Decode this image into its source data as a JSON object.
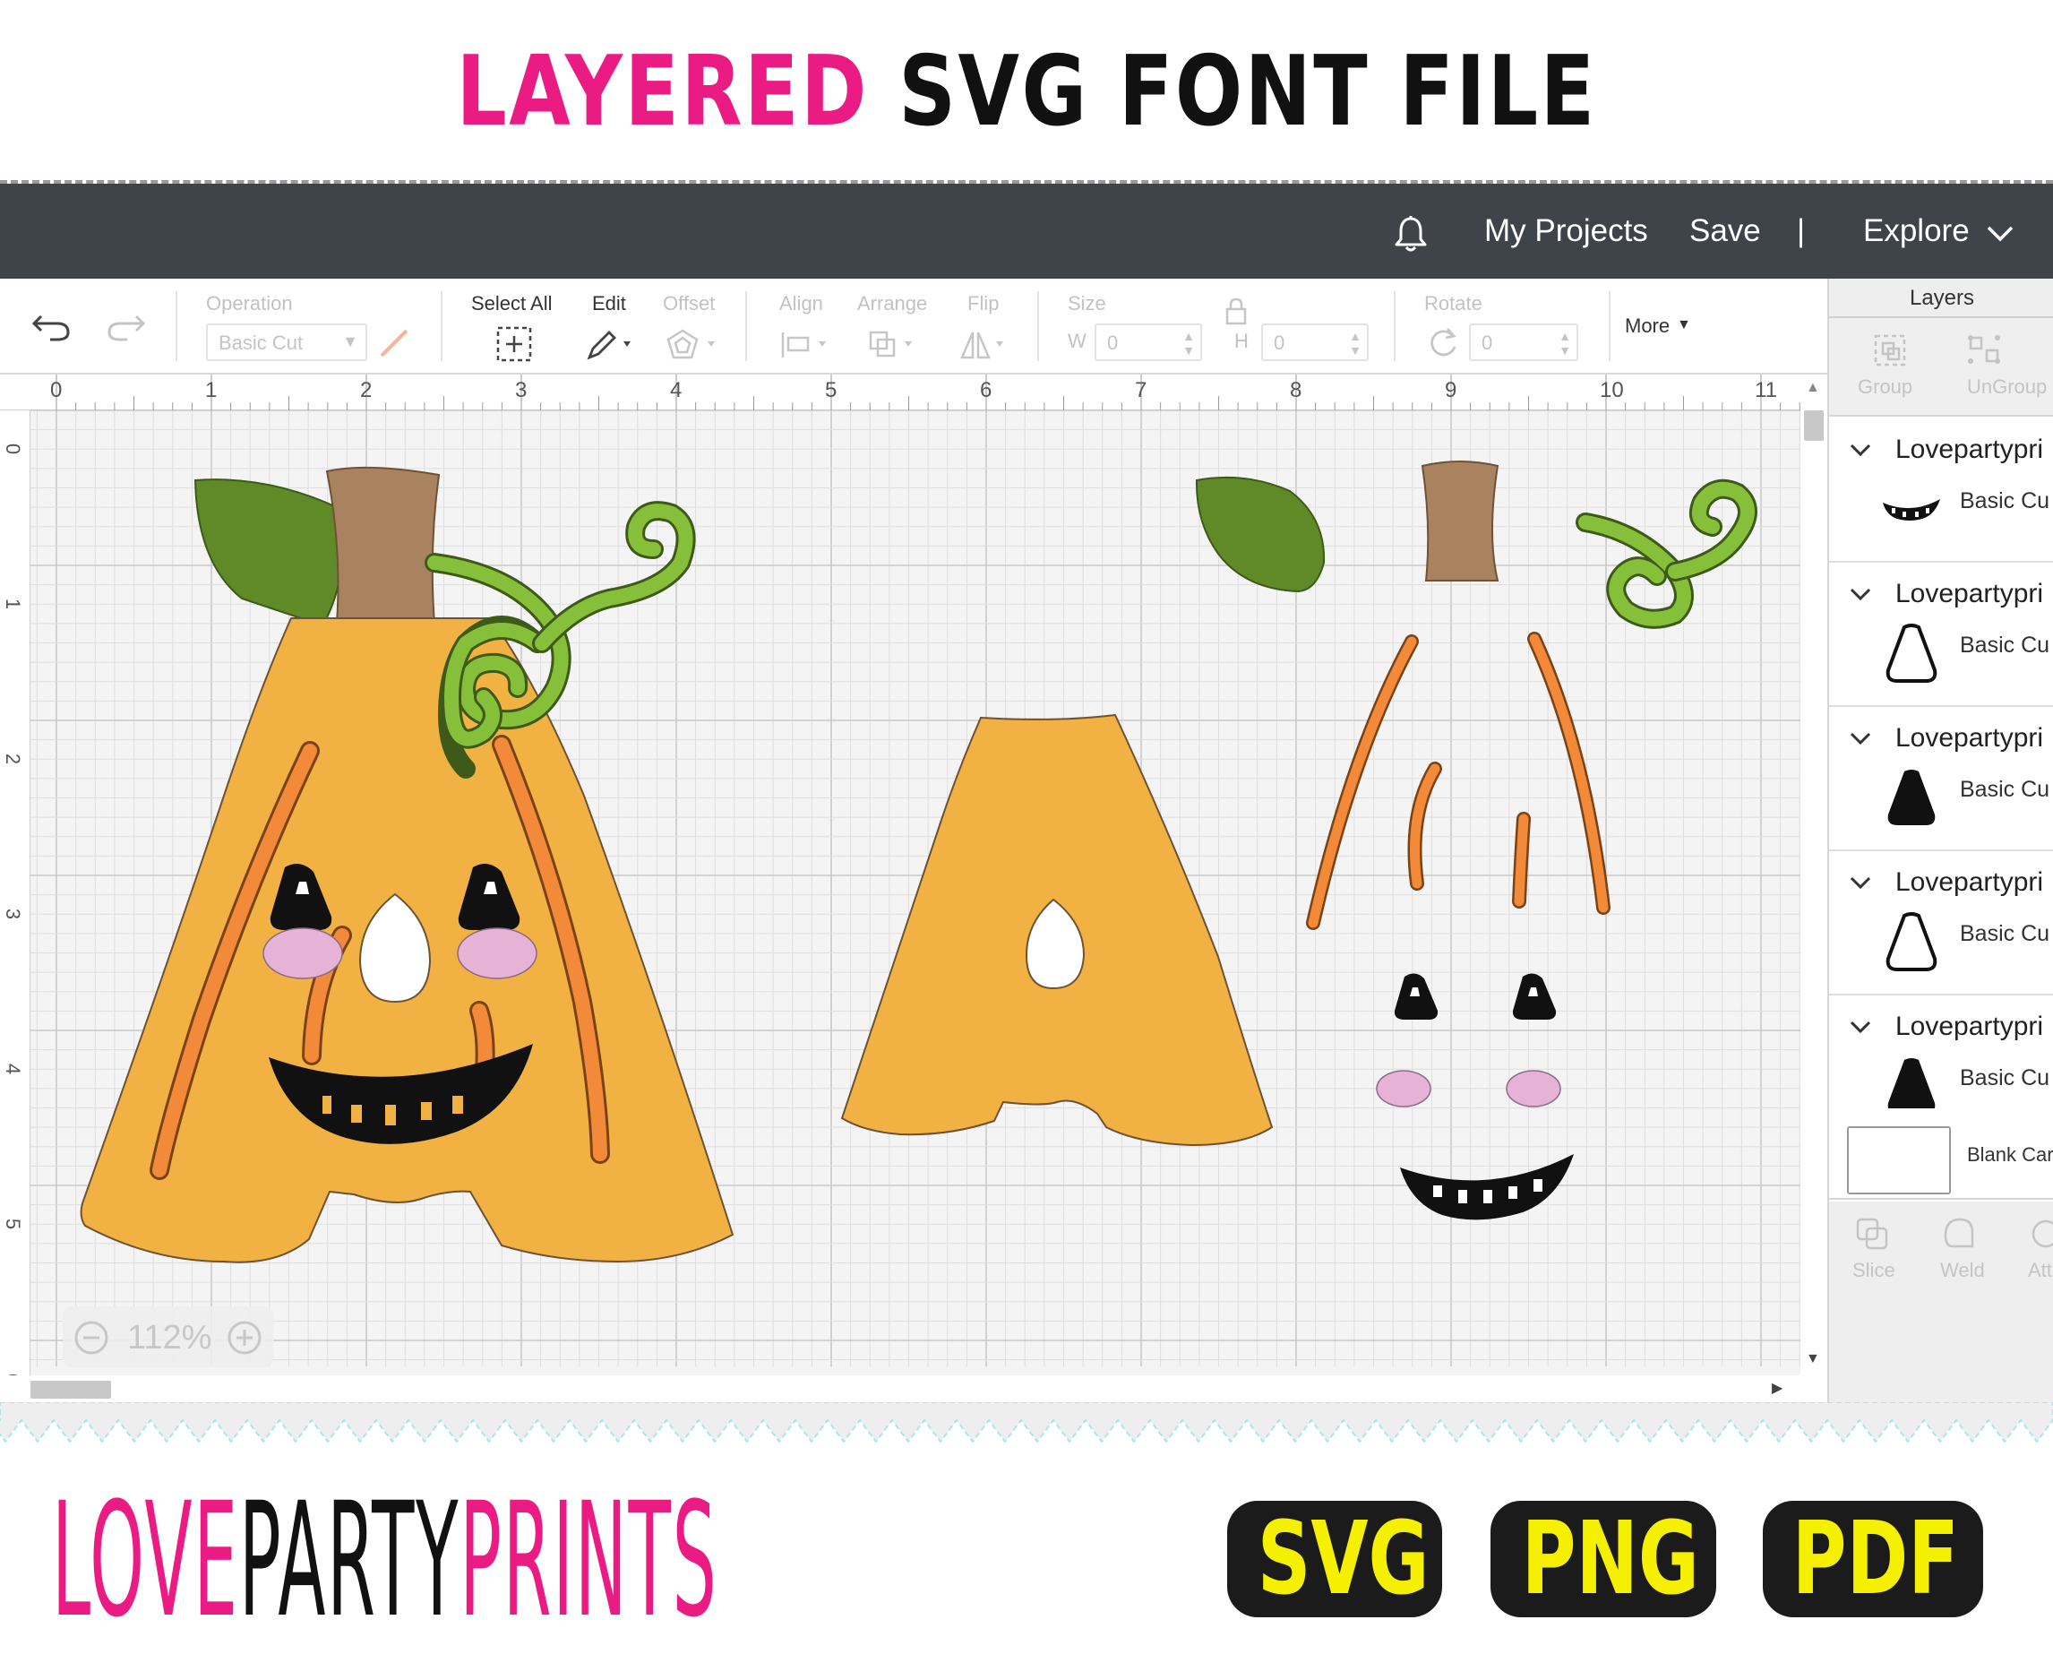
{
  "banner": {
    "title_part1": "LAYERED",
    "title_part2": "SVG FONT FILE"
  },
  "header": {
    "my_projects": "My Projects",
    "save": "Save",
    "divider": "|",
    "explore": "Explore"
  },
  "toolbar": {
    "operation_label": "Operation",
    "operation_value": "Basic Cut",
    "select_all_label": "Select All",
    "edit_label": "Edit",
    "offset_label": "Offset",
    "align_label": "Align",
    "arrange_label": "Arrange",
    "flip_label": "Flip",
    "size_label": "Size",
    "w_label": "W",
    "w_value": "0",
    "h_label": "H",
    "h_value": "0",
    "rotate_label": "Rotate",
    "rotate_value": "0",
    "more_label": "More"
  },
  "ruler": {
    "top": [
      "0",
      "1",
      "2",
      "3",
      "4",
      "5",
      "6",
      "7",
      "8",
      "9",
      "10",
      "11"
    ],
    "left": [
      "0",
      "1",
      "2",
      "3",
      "4",
      "5",
      "6"
    ]
  },
  "zoom": {
    "level": "112%"
  },
  "layers": {
    "title": "Layers",
    "group_label": "Group",
    "ungroup_label": "UnGroup",
    "items": [
      {
        "name": "Lovepartypri",
        "operation": "Basic Cu"
      },
      {
        "name": "Lovepartypri",
        "operation": "Basic Cu"
      },
      {
        "name": "Lovepartypri",
        "operation": "Basic Cu"
      },
      {
        "name": "Lovepartypri",
        "operation": "Basic Cu"
      },
      {
        "name": "Lovepartypri",
        "operation": "Basic Cu"
      }
    ],
    "blank_canvas": "Blank Car",
    "slice_label": "Slice",
    "weld_label": "Weld",
    "attach_label": "Att"
  },
  "footer": {
    "brand_part1": "LOVE",
    "brand_part2": "PARTY",
    "brand_part3": "PRINTS",
    "formats": [
      "SVG",
      "PNG",
      "PDF"
    ]
  },
  "colors": {
    "accent_pink": "#ea1c84",
    "header_bg": "#3f434a",
    "pumpkin": "#f2b143",
    "rib_orange": "#f28a3a",
    "leaf_green": "#5f8a27",
    "vine_green": "#86bf3a",
    "stem_brown": "#a9825f",
    "cheek_pink": "#e6b3d7",
    "badge_yellow": "#f5f000"
  }
}
